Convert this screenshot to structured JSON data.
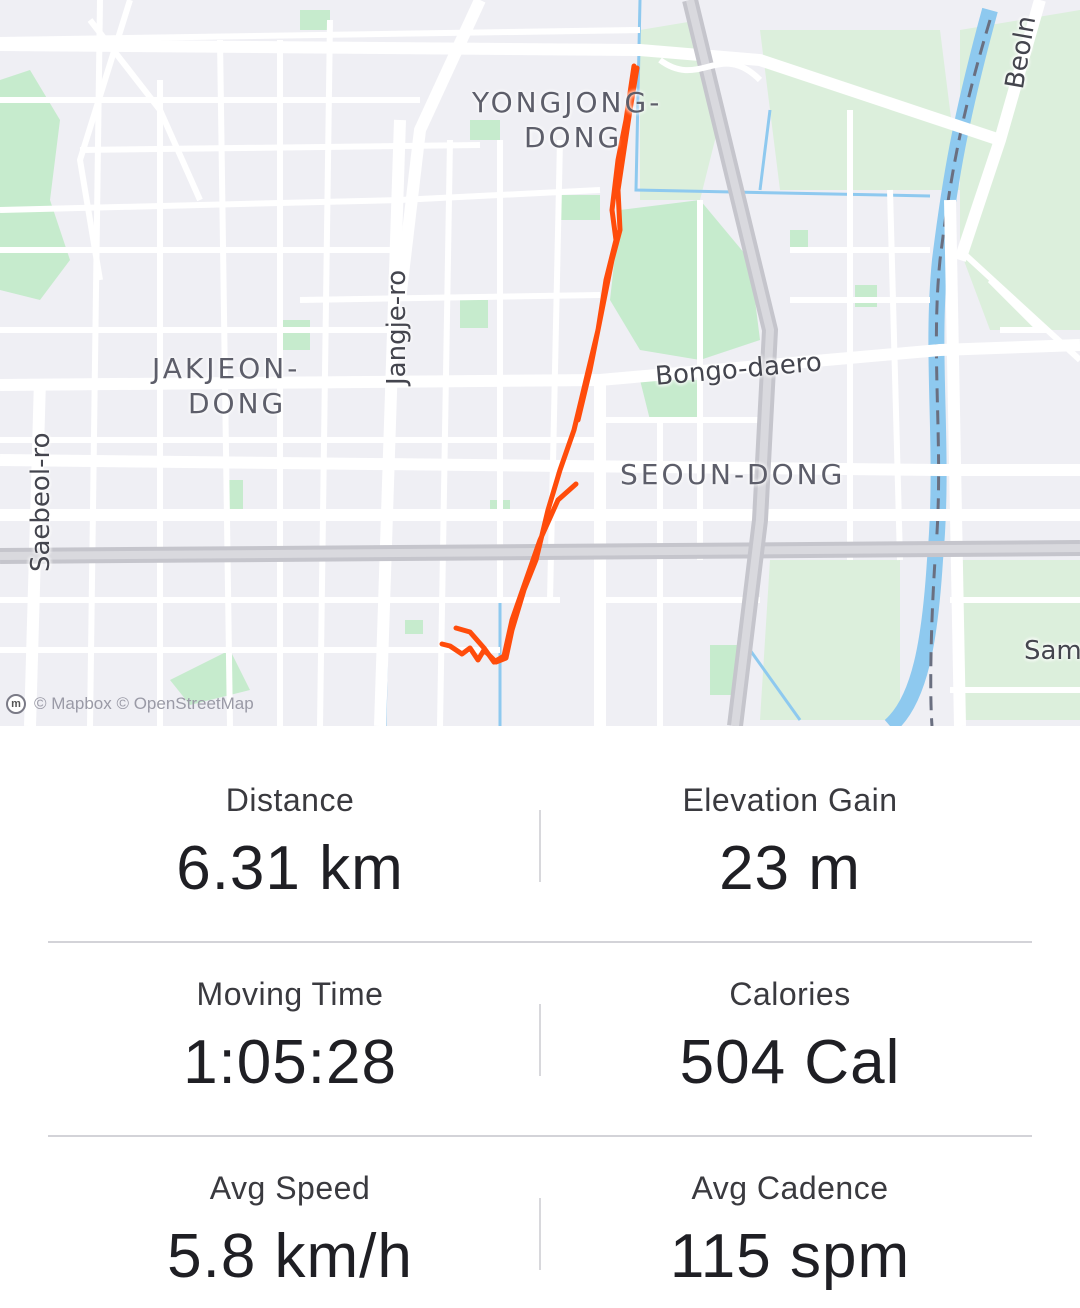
{
  "map": {
    "area_labels": [
      {
        "key": "yongjong",
        "line1": "YONGJONG-",
        "line2": "DONG"
      },
      {
        "key": "jakjeon",
        "line1": "JAKJEON-",
        "line2": "DONG"
      },
      {
        "key": "seoun",
        "line1": "SEOUN-DONG"
      }
    ],
    "street_labels": {
      "jangje": "Jangje-ro",
      "bongo": "Bongo-daero",
      "saebeol": "Saebeol-ro",
      "beoln": "Beoln",
      "sam": "Sam"
    },
    "attribution": "© Mapbox © OpenStreetMap",
    "attribution_icon": "mapbox-logo-icon",
    "route_color": "#ff4c0b",
    "park_color": "#b7e6c0",
    "water_color": "#8ec9ef"
  },
  "stats": [
    {
      "label": "Distance",
      "value": "6.31 km"
    },
    {
      "label": "Elevation Gain",
      "value": "23 m"
    },
    {
      "label": "Moving Time",
      "value": "1:05:28"
    },
    {
      "label": "Calories",
      "value": "504 Cal"
    },
    {
      "label": "Avg Speed",
      "value": "5.8 km/h"
    },
    {
      "label": "Avg Cadence",
      "value": "115 spm"
    }
  ]
}
